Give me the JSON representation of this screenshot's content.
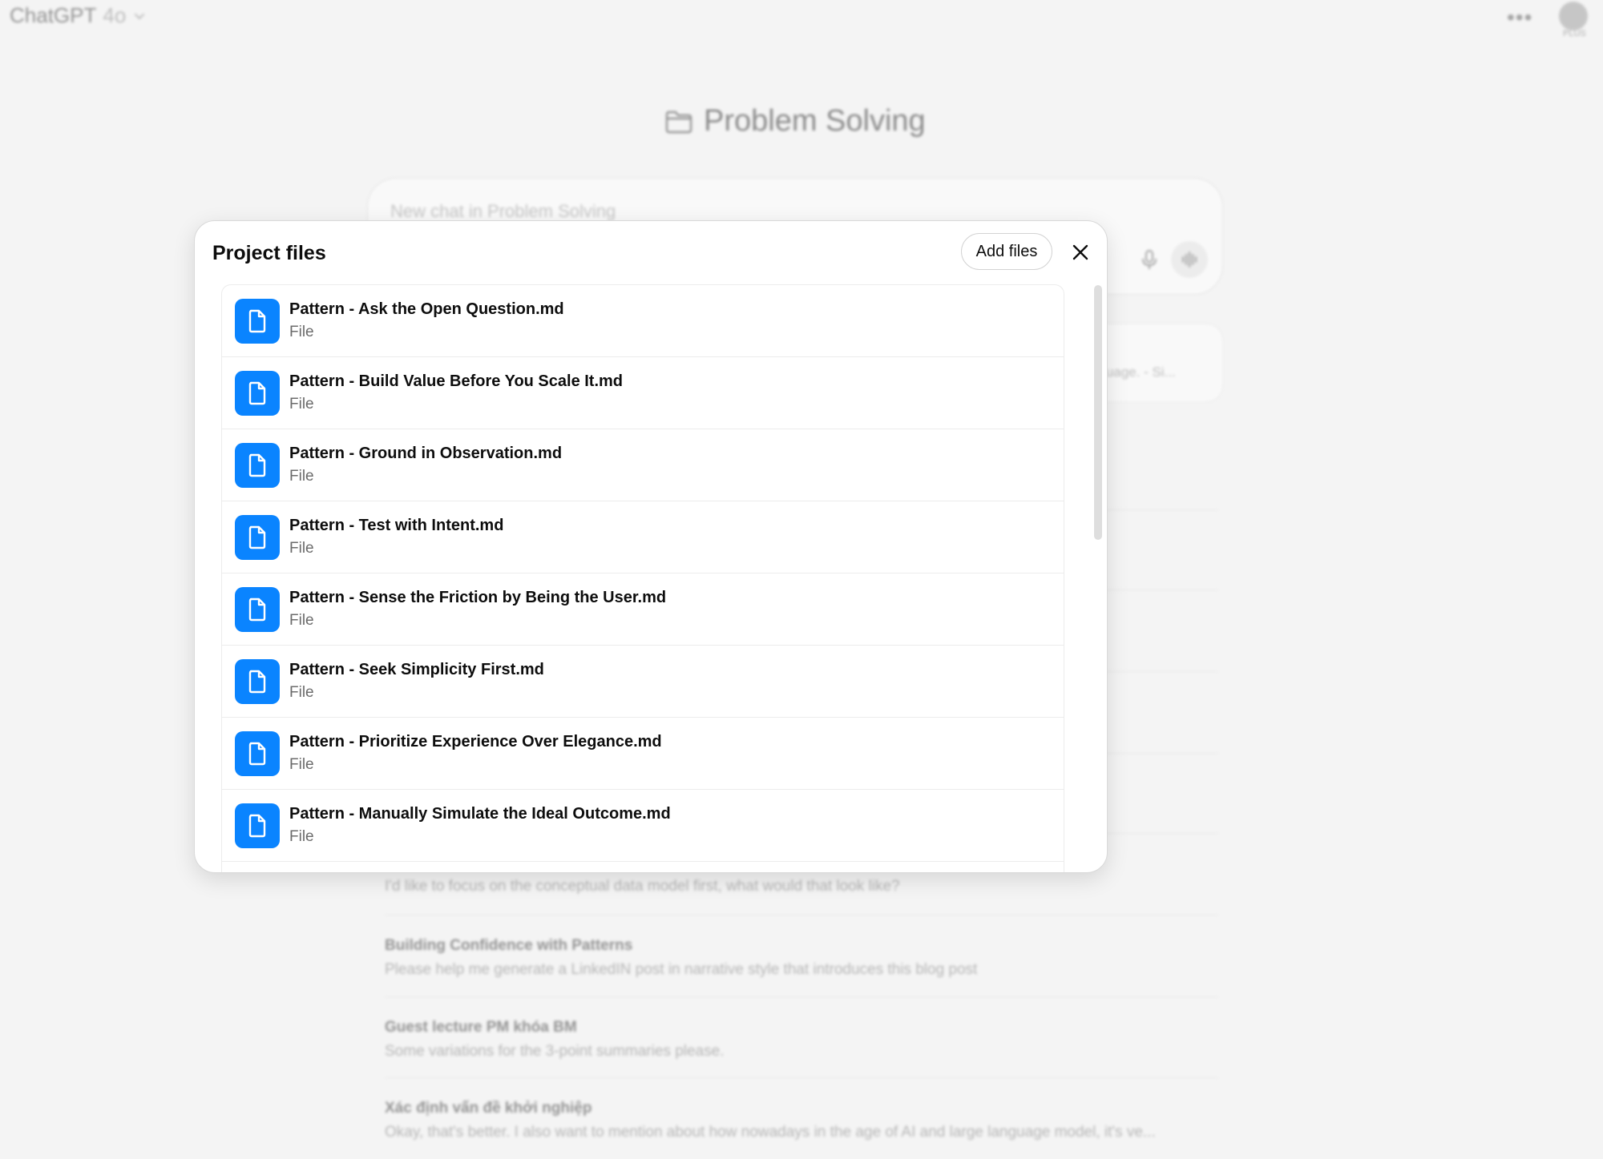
{
  "topbar": {
    "app_name": "ChatGPT",
    "model": "4o",
    "avatar_badge": "PLUS"
  },
  "project": {
    "name": "Problem Solving"
  },
  "composer": {
    "placeholder": "New chat in Problem Solving"
  },
  "ghost_card": {
    "text": "nguage. - Si..."
  },
  "background_chats": {
    "partial_preview": "I'd like to focus on the conceptual data model first, what would that look like?",
    "items": [
      {
        "title": "Building Confidence with Patterns",
        "preview": "Please help me generate a LinkedIN post in narrative style that introduces this blog post"
      },
      {
        "title": "Guest lecture PM khóa BM",
        "preview": "Some variations for the 3-point summaries please."
      },
      {
        "title": "Xác định vấn đề khởi nghiệp",
        "preview": "Okay, that's better. I also want to mention about how nowadays in the age of AI and large language model, it's ve..."
      }
    ]
  },
  "modal": {
    "title": "Project files",
    "add_files_label": "Add files",
    "close_icon": "close-icon",
    "file_icon": "document-icon",
    "accent_color": "#0a84ff",
    "files": [
      {
        "name": "Pattern - Ask the Open Question.md",
        "type": "File"
      },
      {
        "name": "Pattern - Build Value Before You Scale It.md",
        "type": "File"
      },
      {
        "name": "Pattern - Ground in Observation.md",
        "type": "File"
      },
      {
        "name": "Pattern - Test with Intent.md",
        "type": "File"
      },
      {
        "name": "Pattern - Sense the Friction by Being the User.md",
        "type": "File"
      },
      {
        "name": "Pattern - Seek Simplicity First.md",
        "type": "File"
      },
      {
        "name": "Pattern - Prioritize Experience Over Elegance.md",
        "type": "File"
      },
      {
        "name": "Pattern - Manually Simulate the Ideal Outcome.md",
        "type": "File"
      }
    ]
  }
}
